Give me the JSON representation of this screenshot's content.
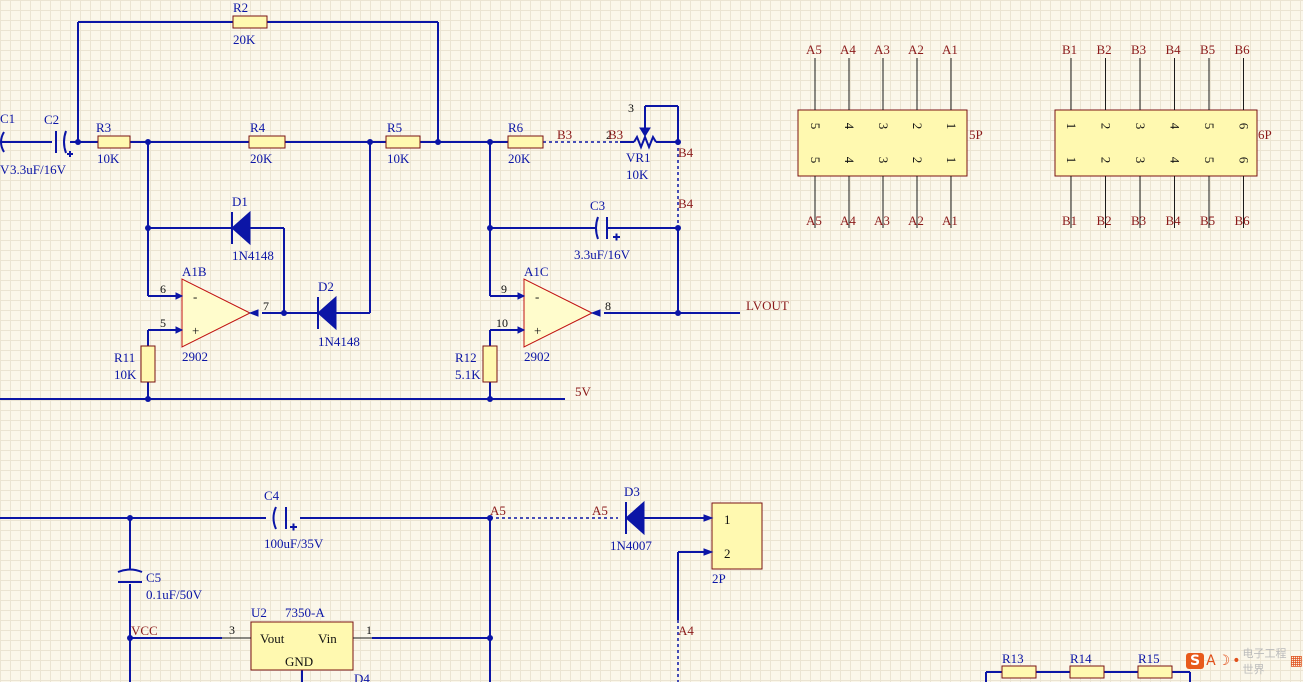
{
  "components": {
    "R2": {
      "ref": "R2",
      "value": "20K"
    },
    "C1": {
      "ref": "C1",
      "value": "V"
    },
    "C2": {
      "ref": "C2",
      "value": "3.3uF/16V"
    },
    "R3": {
      "ref": "R3",
      "value": "10K"
    },
    "R4": {
      "ref": "R4",
      "value": "20K"
    },
    "R5": {
      "ref": "R5",
      "value": "10K"
    },
    "R6": {
      "ref": "R6",
      "value": "20K"
    },
    "VR1": {
      "ref": "VR1",
      "value": "10K"
    },
    "D1": {
      "ref": "D1",
      "value": "1N4148"
    },
    "D2": {
      "ref": "D2",
      "value": "1N4148"
    },
    "C3": {
      "ref": "C3",
      "value": "3.3uF/16V"
    },
    "A1B": {
      "ref": "A1B",
      "value": "2902"
    },
    "A1C": {
      "ref": "A1C",
      "value": "2902"
    },
    "R11": {
      "ref": "R11",
      "value": "10K"
    },
    "R12": {
      "ref": "R12",
      "value": "5.1K"
    },
    "C4": {
      "ref": "C4",
      "value": "100uF/35V"
    },
    "C5": {
      "ref": "C5",
      "value": "0.1uF/50V"
    },
    "D3": {
      "ref": "D3",
      "value": "1N4007"
    },
    "U2": {
      "ref": "U2",
      "value": "7350-A",
      "pin_vout": "Vout",
      "pin_vin": "Vin",
      "pin_gnd": "GND"
    },
    "D4": {
      "ref": "D4"
    },
    "R13": {
      "ref": "R13"
    },
    "R14": {
      "ref": "R14"
    },
    "R15": {
      "ref": "R15"
    },
    "J5P": {
      "ref": "5P"
    },
    "J6P": {
      "ref": "6P"
    },
    "J2P": {
      "ref": "2P"
    }
  },
  "nets": {
    "B3": "B3",
    "B4": "B4",
    "A5": "A5",
    "A4": "A4",
    "LVOUT": "LVOUT",
    "V5": "5V",
    "VCC": "VCC"
  },
  "pins": {
    "opB_inv": "6",
    "opB_noninv": "5",
    "opB_out": "7",
    "opC_inv": "9",
    "opC_noninv": "10",
    "opC_out": "8",
    "vr_wiper": "3",
    "vr_end": "2",
    "u2_out": "3",
    "u2_in": "1",
    "j2p_1": "1",
    "j2p_2": "2",
    "minus": "-",
    "plus": "+"
  },
  "connector_5p": {
    "top_labels": [
      "A5",
      "A4",
      "A3",
      "A2",
      "A1"
    ],
    "pins": [
      "5",
      "4",
      "3",
      "2",
      "1"
    ],
    "bottom_labels": [
      "A5",
      "A4",
      "A3",
      "A2",
      "A1"
    ]
  },
  "connector_6p": {
    "top_labels": [
      "B1",
      "B2",
      "B3",
      "B4",
      "B5",
      "B6"
    ],
    "pins": [
      "1",
      "2",
      "3",
      "4",
      "5",
      "6"
    ],
    "bottom_labels": [
      "B1",
      "B2",
      "B3",
      "B4",
      "B5",
      "B6"
    ]
  },
  "watermark": {
    "s": "S",
    "a": "A",
    "moon": "☽",
    "dot": "•",
    "text": "电子工程世界",
    "kbd": "▦"
  },
  "colors": {
    "wire": "#0b15a6",
    "body": "#fff9b0",
    "outline": "#7a1212",
    "opamp_outline": "#c01010",
    "net_label": "#8b1a1a"
  }
}
